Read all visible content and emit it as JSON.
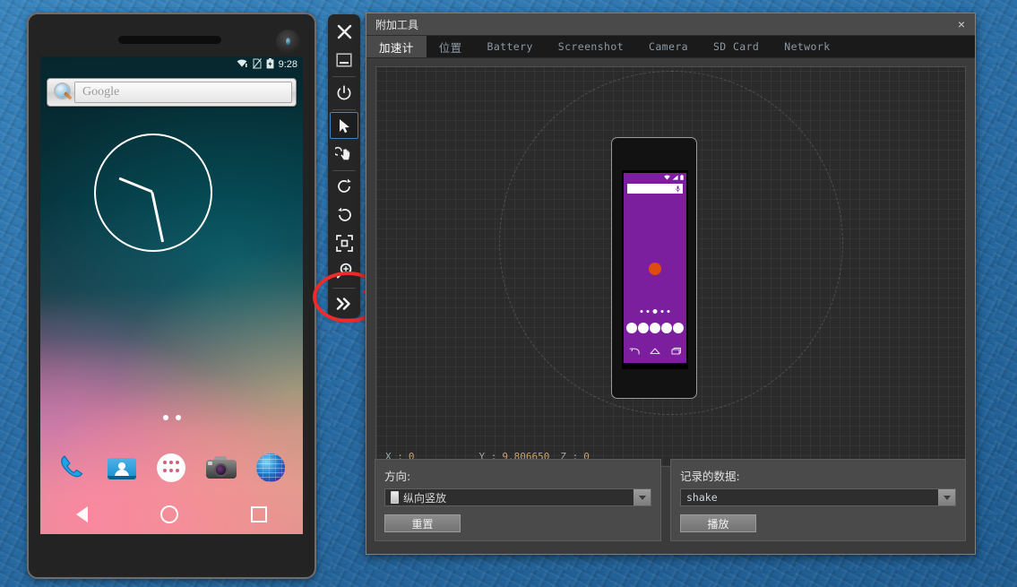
{
  "window": {
    "title": "附加工具",
    "close_label": "×"
  },
  "tabs": [
    {
      "label": "加速计",
      "active": true,
      "cn": true
    },
    {
      "label": "位置",
      "active": false,
      "cn": true
    },
    {
      "label": "Battery",
      "active": false,
      "cn": false
    },
    {
      "label": "Screenshot",
      "active": false,
      "cn": false
    },
    {
      "label": "Camera",
      "active": false,
      "cn": false
    },
    {
      "label": "SD Card",
      "active": false,
      "cn": false
    },
    {
      "label": "Network",
      "active": false,
      "cn": false
    }
  ],
  "sensor": {
    "readout": {
      "x_key": "X :",
      "x_value": "0",
      "y_key": "Y :",
      "y_value": "9.806650",
      "z_key": "Z :",
      "z_value": "0"
    }
  },
  "panel_left": {
    "label": "方向:",
    "combo_value": "纵向竖放",
    "button_label": "重置"
  },
  "panel_right": {
    "label": "记录的数据:",
    "combo_value": "shake",
    "button_label": "播放"
  },
  "toolbar": {
    "items": [
      {
        "name": "close",
        "glyph": "✕"
      },
      {
        "name": "minimize",
        "glyph": "▭"
      },
      {
        "name": "power",
        "glyph": "⏻"
      },
      {
        "name": "pointer",
        "glyph": "➤"
      },
      {
        "name": "touch",
        "glyph": "☝"
      },
      {
        "name": "rotate-left",
        "glyph": "↺"
      },
      {
        "name": "rotate-right",
        "glyph": "↻"
      },
      {
        "name": "fullscreen",
        "glyph": "⛶"
      },
      {
        "name": "zoom",
        "glyph": "⊕"
      },
      {
        "name": "more",
        "glyph": "»"
      }
    ]
  },
  "device": {
    "status_time": "9:28",
    "search_placeholder": "Google",
    "dock_icons": [
      "phone-icon",
      "contacts-icon",
      "apps-icon",
      "camera-icon",
      "browser-icon"
    ],
    "nav_icons": [
      "back-icon",
      "home-icon",
      "recents-icon"
    ]
  },
  "colors": {
    "accent_blue": "#3a86c8",
    "annotation_red": "#ee2a2a",
    "mock_purple": "#7b1f9e",
    "mock_orange": "#e04b10",
    "panel_gray": "#4a4a4a",
    "canvas_dark": "#2b2b2b"
  }
}
